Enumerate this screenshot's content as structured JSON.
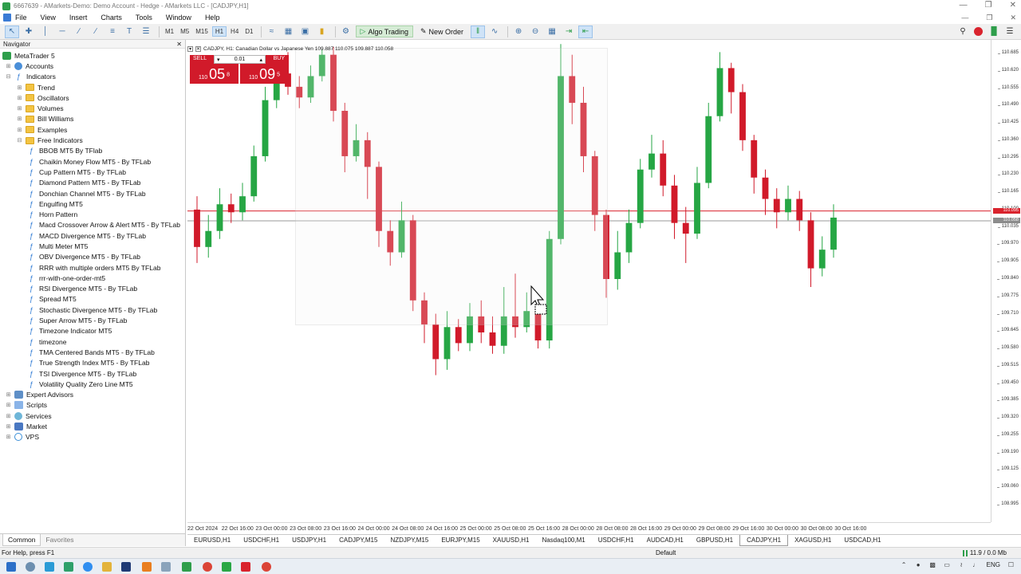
{
  "window": {
    "title": "6667639 - AMarkets-Demo: Demo Account - Hedge - AMarkets LLC - [CADJPY,H1]"
  },
  "menu": [
    "File",
    "View",
    "Insert",
    "Charts",
    "Tools",
    "Window",
    "Help"
  ],
  "toolbar": {
    "timeframes": [
      "M1",
      "M5",
      "M15",
      "H1",
      "H4",
      "D1"
    ],
    "active_timeframe": "H1",
    "algo_trading_label": "Algo Trading",
    "new_order_label": "New Order"
  },
  "navigator": {
    "title": "Navigator",
    "root": "MetaTrader 5",
    "accounts": "Accounts",
    "indicators": "Indicators",
    "folders": [
      "Trend",
      "Oscillators",
      "Volumes",
      "Bill Williams",
      "Examples",
      "Free Indicators"
    ],
    "free_indicators": [
      "BBOB MT5 By TFlab",
      "Chaikin Money Flow MT5 - By TFLab",
      "Cup Pattern MT5 - By TFLab",
      "Diamond Pattern MT5 - By TFLab",
      "Donchian Channel MT5 - By TFLab",
      "Engulfing MT5",
      "Horn Pattern",
      "Macd Crossover Arrow & Alert MT5 - By TFLab",
      "MACD Divergence MT5 - By TFLab",
      "Multi Meter MT5",
      "OBV Divergence MT5 - By TFLab",
      "RRR with multiple orders MT5 By TFLab",
      "rrr-with-one-order-mt5",
      "RSI Divergence MT5 - By TFLab",
      "Spread MT5",
      "Stochastic Divergence MT5 - By TFLab",
      "Super Arrow MT5 - By TFLab",
      "Timezone Indicator MT5",
      "timezone",
      "TMA Centered Bands MT5 - By TFLab",
      "True Strength Index MT5 - By TFLab",
      "TSI Divergence MT5 - By TFLab",
      "Volatility Quality Zero Line MT5"
    ],
    "bottom_items": [
      "Expert Advisors",
      "Scripts",
      "Services",
      "Market",
      "VPS"
    ],
    "tabs": [
      "Common",
      "Favorites"
    ]
  },
  "chart": {
    "header": "CADJPY, H1:  Canadian Dollar vs Japanese Yen  109.887 110.075 109.887 110.058",
    "trade": {
      "sell_label": "SELL",
      "buy_label": "BUY",
      "lot": "0.01",
      "sell_price_prefix": "110",
      "sell_price_big": "05",
      "sell_price_sup": "8",
      "buy_price_prefix": "110",
      "buy_price_big": "09",
      "buy_price_sup": "5"
    },
    "price_ticks": [
      "110.685",
      "110.620",
      "110.555",
      "110.490",
      "110.425",
      "110.360",
      "110.295",
      "110.230",
      "110.165",
      "110.100",
      "110.035",
      "109.970",
      "109.905",
      "109.840",
      "109.775",
      "109.710",
      "109.645",
      "109.580",
      "109.515",
      "109.450",
      "109.385",
      "109.320",
      "109.255",
      "109.190",
      "109.125",
      "109.060",
      "108.995"
    ],
    "price_tags": [
      {
        "label": "110.095",
        "color": "#d9232d"
      },
      {
        "label": "110.058",
        "color": "#8c8c8c"
      }
    ],
    "time_ticks": [
      "22 Oct 2024",
      "22 Oct 16:00",
      "23 Oct 00:00",
      "23 Oct 08:00",
      "23 Oct 16:00",
      "24 Oct 00:00",
      "24 Oct 08:00",
      "24 Oct 16:00",
      "25 Oct 00:00",
      "25 Oct 08:00",
      "25 Oct 16:00",
      "28 Oct 00:00",
      "28 Oct 08:00",
      "28 Oct 16:00",
      "29 Oct 00:00",
      "29 Oct 08:00",
      "29 Oct 16:00",
      "30 Oct 00:00",
      "30 Oct 08:00",
      "30 Oct 16:00"
    ],
    "colors": {
      "bull": "#26a644",
      "bear": "#d11a2a",
      "sell_panel": "#d11a2a",
      "ask_line": "#d9232d",
      "bid_line": "#9a9a9a"
    },
    "candles": [
      [
        110.1,
        109.96,
        110.15,
        109.9
      ],
      [
        109.96,
        110.02,
        110.08,
        109.92
      ],
      [
        110.02,
        110.12,
        110.18,
        109.99
      ],
      [
        110.12,
        110.09,
        110.16,
        110.05
      ],
      [
        110.09,
        110.15,
        110.2,
        110.06
      ],
      [
        110.15,
        110.3,
        110.34,
        110.13
      ],
      [
        110.3,
        110.51,
        110.56,
        110.28
      ],
      [
        110.51,
        110.61,
        110.66,
        110.48
      ],
      [
        110.61,
        110.56,
        110.69,
        110.53
      ],
      [
        110.56,
        110.52,
        110.6,
        110.48
      ],
      [
        110.52,
        110.6,
        110.64,
        110.5
      ],
      [
        110.6,
        110.68,
        110.7,
        110.58
      ],
      [
        110.68,
        110.47,
        110.71,
        110.43
      ],
      [
        110.47,
        110.3,
        110.5,
        110.24
      ],
      [
        110.3,
        110.36,
        110.42,
        110.28
      ],
      [
        110.36,
        110.26,
        110.39,
        110.14
      ],
      [
        110.26,
        110.02,
        110.28,
        109.96
      ],
      [
        110.02,
        109.94,
        110.06,
        109.89
      ],
      [
        109.94,
        110.06,
        110.13,
        109.92
      ],
      [
        110.06,
        109.76,
        110.08,
        109.72
      ],
      [
        109.76,
        109.67,
        109.79,
        109.6
      ],
      [
        109.67,
        109.54,
        109.71,
        109.48
      ],
      [
        109.54,
        109.66,
        109.72,
        109.5
      ],
      [
        109.66,
        109.6,
        109.69,
        109.57
      ],
      [
        109.6,
        109.7,
        109.75,
        109.57
      ],
      [
        109.7,
        109.64,
        109.76,
        109.6
      ],
      [
        109.64,
        109.59,
        109.7,
        109.56
      ],
      [
        109.59,
        109.7,
        109.81,
        109.56
      ],
      [
        109.7,
        109.66,
        109.86,
        109.62
      ],
      [
        109.66,
        109.72,
        109.79,
        109.64
      ],
      [
        109.72,
        109.61,
        109.75,
        109.58
      ],
      [
        109.61,
        109.99,
        110.02,
        109.58
      ],
      [
        109.99,
        110.6,
        110.72,
        109.97
      ],
      [
        110.6,
        110.5,
        110.68,
        110.42
      ],
      [
        110.5,
        110.3,
        110.56,
        110.24
      ],
      [
        110.3,
        110.08,
        110.32,
        110.02
      ],
      [
        110.08,
        109.84,
        110.1,
        109.77
      ],
      [
        109.84,
        109.94,
        110.02,
        109.8
      ],
      [
        109.94,
        110.05,
        110.1,
        109.9
      ],
      [
        110.05,
        110.25,
        110.29,
        110.03
      ],
      [
        110.25,
        110.31,
        110.38,
        110.22
      ],
      [
        110.31,
        110.19,
        110.36,
        110.15
      ],
      [
        110.19,
        110.05,
        110.23,
        109.99
      ],
      [
        110.05,
        110.01,
        110.11,
        109.9
      ],
      [
        110.01,
        110.2,
        110.26,
        109.99
      ],
      [
        110.2,
        110.45,
        110.5,
        110.18
      ],
      [
        110.45,
        110.63,
        110.69,
        110.43
      ],
      [
        110.63,
        110.54,
        110.65,
        110.46
      ],
      [
        110.54,
        110.36,
        110.57,
        110.32
      ],
      [
        110.36,
        110.22,
        110.38,
        110.16
      ],
      [
        110.22,
        110.14,
        110.25,
        110.08
      ],
      [
        110.14,
        110.09,
        110.18,
        110.03
      ],
      [
        110.09,
        110.14,
        110.19,
        110.06
      ],
      [
        110.14,
        110.06,
        110.17,
        110.02
      ],
      [
        110.06,
        109.88,
        110.09,
        109.81
      ],
      [
        109.88,
        109.95,
        110.0,
        109.85
      ],
      [
        109.95,
        110.07,
        110.12,
        109.92
      ]
    ]
  },
  "symbol_tabs": [
    "EURUSD,H1",
    "USDCHF,H1",
    "USDJPY,H1",
    "CADJPY,M15",
    "NZDJPY,M15",
    "EURJPY,M15",
    "XAUUSD,H1",
    "Nasdaq100,M1",
    "USDCHF,H1",
    "AUDCAD,H1",
    "GBPUSD,H1",
    "CADJPY,H1",
    "XAGUSD,H1",
    "USDCAD,H1"
  ],
  "active_symbol_tab": "CADJPY,H1",
  "status": {
    "help": "For Help, press F1",
    "profile": "Default",
    "traffic": "11.9 / 0.0 Mb"
  },
  "taskbar": {
    "lang": "ENG"
  }
}
